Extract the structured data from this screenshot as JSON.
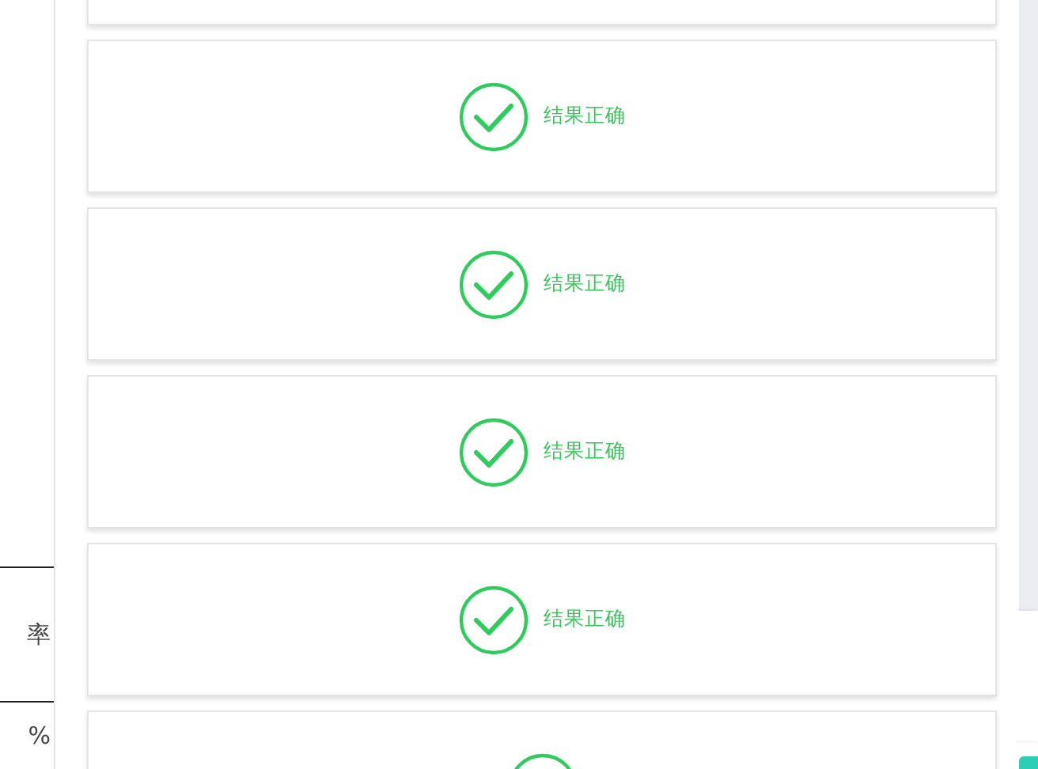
{
  "stats_table": {
    "header": "率",
    "value": "%"
  },
  "results": [
    {
      "correct": true,
      "label": "结果正确"
    },
    {
      "correct": true,
      "label": "结果正确"
    },
    {
      "correct": true,
      "label": "结果正确"
    },
    {
      "correct": true,
      "label": "结果正确"
    },
    {
      "correct": true
    }
  ]
}
